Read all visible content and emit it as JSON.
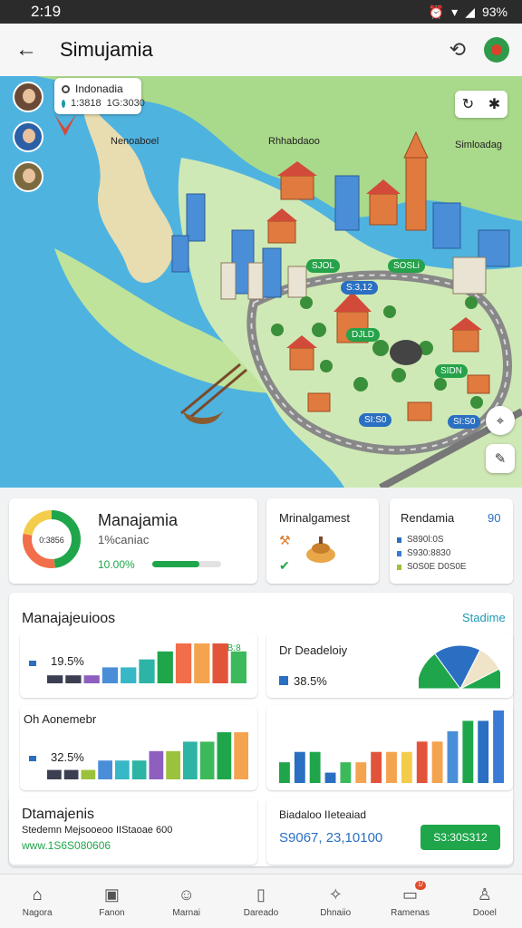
{
  "status": {
    "time": "2:19",
    "battery": "93%"
  },
  "header": {
    "title": "Simujamia"
  },
  "map": {
    "location_title": "Indonadia",
    "location_stat_1": "1:3818",
    "location_stat_2": "1G:3030",
    "labels": [
      "Nenoaboel",
      "Rhhabdaoo",
      "Simloadag"
    ],
    "pills": [
      "SJOL",
      "SOSLi",
      "S:3,12",
      "SIDN",
      "SI:S0",
      "SI:S0",
      "DJLD"
    ]
  },
  "stats_card_1": {
    "title": "Manajamia",
    "subtitle": "1%caniac",
    "progress_label": "10.00%",
    "donut_label": "0:3856",
    "progress": 0.68,
    "donut_segments": [
      {
        "value": 48,
        "color": "#1fa64b"
      },
      {
        "value": 30,
        "color": "#f16e4a"
      },
      {
        "value": 22,
        "color": "#f4cc4c"
      }
    ]
  },
  "stats_card_2": {
    "title": "Mrinalgamest"
  },
  "stats_card_3": {
    "title": "Rendamia",
    "badge": "90",
    "items": [
      {
        "label": "S890l:0S",
        "color": "#2a6fc2"
      },
      {
        "label": "S930:8830",
        "color": "#3a7bd5"
      },
      {
        "label": "S0S0E D0S0E",
        "color": "#9bc23c"
      }
    ]
  },
  "section": {
    "title": "Manajajeuioos",
    "link": "Stadime"
  },
  "chart_1": {
    "legend": "19.5%",
    "value_label": "BB:8"
  },
  "chart_2": {
    "title": "Dr Deadeloiy",
    "legend": "38.5%"
  },
  "chart_3": {
    "title": "Oh Aonemebr",
    "legend": "32.5%"
  },
  "info_card_1": {
    "title": "Dtamajenis",
    "line": "Stedemn Mejsooeoo IIStaoae 600",
    "link": "www.1S6S080606"
  },
  "info_card_2": {
    "title": "Biadaloo IIeteaiad",
    "value": "S9067, 23,10100",
    "button": "S3:30S312"
  },
  "nav": [
    {
      "icon": "home-icon",
      "label": "Nagora"
    },
    {
      "icon": "store-icon",
      "label": "Fanon"
    },
    {
      "icon": "people-icon",
      "label": "Marnai"
    },
    {
      "icon": "book-icon",
      "label": "Dareado"
    },
    {
      "icon": "compass-icon",
      "label": "Dhnaiio"
    },
    {
      "icon": "inbox-icon",
      "label": "Ramenas",
      "badge": "1/"
    },
    {
      "icon": "person-icon",
      "label": "Dooel"
    }
  ],
  "colors": {
    "accent": "#1fa64b",
    "link": "#1c9bb1",
    "sea": "#4fb3e0",
    "land": "#a9d98a"
  },
  "chart_data": [
    {
      "type": "bar",
      "values": [
        1,
        1,
        1,
        2,
        2,
        3,
        4,
        5,
        5,
        5,
        4
      ],
      "colors": [
        "#3c3f52",
        "#3c3f52",
        "#8f5fc0",
        "#4a8ed8",
        "#38b7c6",
        "#2db4a4",
        "#1fa64b",
        "#f16e4a",
        "#f4a34f",
        "#e2543a",
        "#3cba5b"
      ]
    },
    {
      "type": "pie",
      "values": [
        30,
        35,
        20,
        15
      ],
      "colors": [
        "#1fa64b",
        "#2a6fc2",
        "#efe4c8",
        "#1fa64b"
      ]
    },
    {
      "type": "bar",
      "values": [
        1,
        1,
        1,
        2,
        2,
        2,
        3,
        3,
        4,
        4,
        5,
        5
      ],
      "colors": [
        "#3c3f52",
        "#3c3f52",
        "#9bc23c",
        "#4a8ed8",
        "#38b7c6",
        "#2db4a4",
        "#8f5fc0",
        "#9bc23c",
        "#2db4a4",
        "#3cba5b",
        "#1fa64b",
        "#f4a34f"
      ]
    },
    {
      "type": "bar",
      "values": [
        2,
        3,
        3,
        1,
        2,
        2,
        3,
        3,
        3,
        4,
        4,
        5,
        6,
        6,
        7
      ],
      "colors": [
        "#1fa64b",
        "#2a6fc2",
        "#1fa64b",
        "#2a6fc2",
        "#3cba5b",
        "#f4a34f",
        "#e2543a",
        "#f4a34f",
        "#f4cc4c",
        "#e2543a",
        "#f4a34f",
        "#4a8ed8",
        "#1fa64b",
        "#2a6fc2",
        "#3a7bd5"
      ]
    }
  ]
}
